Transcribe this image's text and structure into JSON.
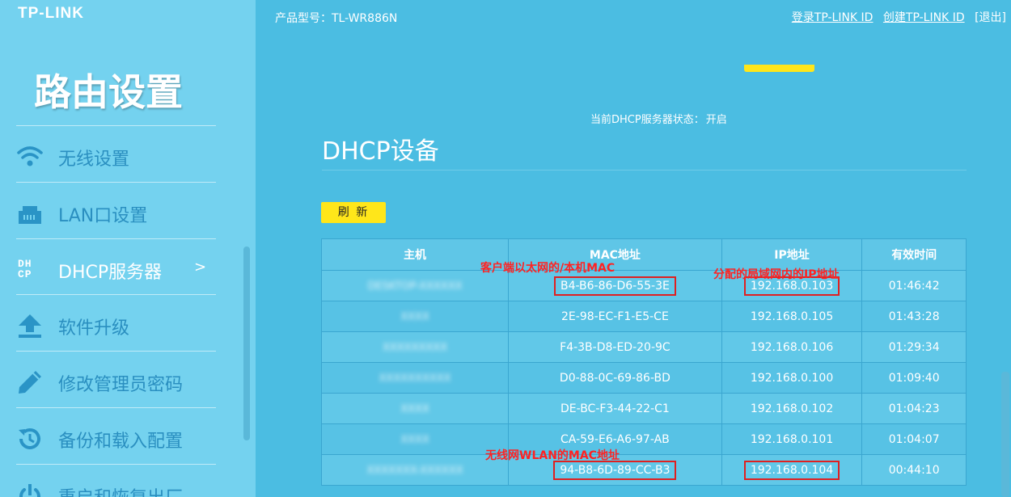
{
  "brand": {
    "logo": "TP-LINK"
  },
  "header": {
    "model_label": "产品型号：TL-WR886N",
    "login_link": "登录TP-LINK ID",
    "create_link": "创建TP-LINK ID",
    "logout": "[退出]"
  },
  "sidebar": {
    "title": "路由设置",
    "items": [
      {
        "label": "无线设置",
        "icon": "wifi-icon"
      },
      {
        "label": "LAN口设置",
        "icon": "lan-port-icon"
      },
      {
        "label": "DHCP服务器",
        "icon": "dhcp-icon",
        "icon_text": "DH\nCP",
        "arrow": ">"
      },
      {
        "label": "软件升级",
        "icon": "upload-icon"
      },
      {
        "label": "修改管理员密码",
        "icon": "pencil-icon"
      },
      {
        "label": "备份和载入配置",
        "icon": "history-icon"
      },
      {
        "label": "重启和恢复出厂",
        "icon": "power-icon"
      }
    ]
  },
  "main": {
    "dhcp_status": {
      "label": "当前DHCP服务器状态：",
      "value": "开启"
    },
    "section_title": "DHCP设备",
    "refresh_label": "刷 新",
    "table": {
      "headers": [
        "主机",
        "MAC地址",
        "IP地址",
        "有效时间"
      ],
      "rows": [
        {
          "host": "DESKTOP-XXXXXX",
          "mac": "B4-B6-86-D6-55-3E",
          "ip": "192.168.0.103",
          "time": "01:46:42",
          "boxed": true
        },
        {
          "host": "XXXX",
          "mac": "2E-98-EC-F1-E5-CE",
          "ip": "192.168.0.105",
          "time": "01:43:28",
          "boxed": false
        },
        {
          "host": "XXXXXXXXX",
          "mac": "F4-3B-D8-ED-20-9C",
          "ip": "192.168.0.106",
          "time": "01:29:34",
          "boxed": false
        },
        {
          "host": "XXXXXXXXXX",
          "mac": "D0-88-0C-69-86-BD",
          "ip": "192.168.0.100",
          "time": "01:09:40",
          "boxed": false
        },
        {
          "host": "XXXX",
          "mac": "DE-BC-F3-44-22-C1",
          "ip": "192.168.0.102",
          "time": "01:04:23",
          "boxed": false
        },
        {
          "host": "XXXX",
          "mac": "CA-59-E6-A6-97-AB",
          "ip": "192.168.0.101",
          "time": "01:04:07",
          "boxed": false
        },
        {
          "host": "XXXXXXX-XXXXXX",
          "mac": "94-B8-6D-89-CC-B3",
          "ip": "192.168.0.104",
          "time": "00:44:10",
          "boxed": true
        }
      ]
    },
    "annotations": {
      "mac_wired": "客户端以太网的/本机MAC",
      "ip_assigned": "分配的局域网内的IP地址",
      "mac_wireless": "无线网WLAN的MAC地址"
    }
  },
  "colors": {
    "accent_yellow": "#ffe61a",
    "annotation_red": "#e02020",
    "page_bg": "#4bbde2",
    "sidebar_bg": "#74d2ef"
  }
}
